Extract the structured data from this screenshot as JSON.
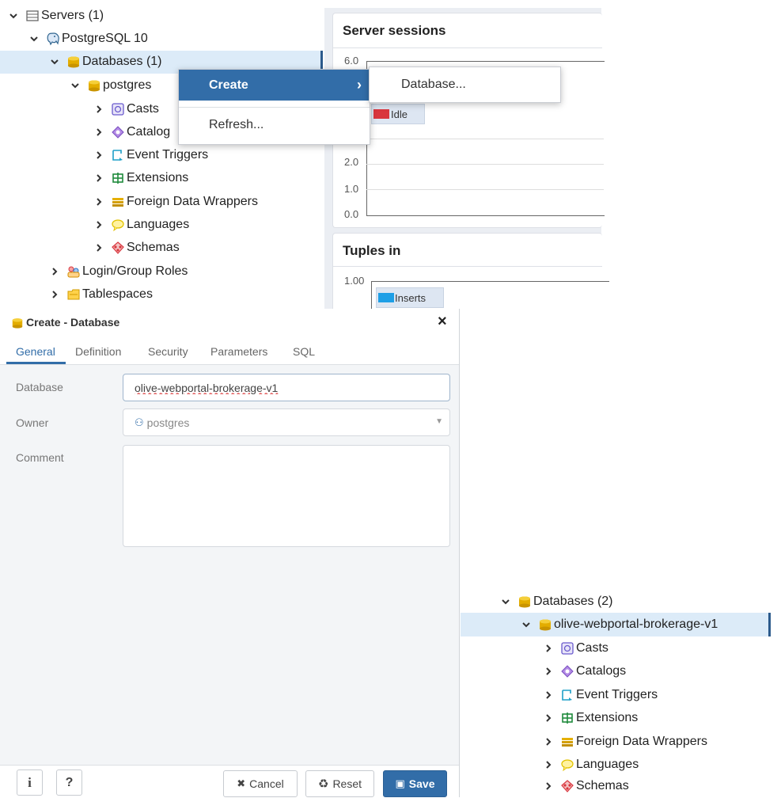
{
  "tree_top": {
    "servers": "Servers (1)",
    "postgresql": "PostgreSQL 10",
    "databases": "Databases (1)",
    "postgres": "postgres",
    "children": [
      "Casts",
      "Catalog",
      "Event Triggers",
      "Extensions",
      "Foreign Data Wrappers",
      "Languages",
      "Schemas"
    ],
    "login_roles": "Login/Group Roles",
    "tablespaces": "Tablespaces"
  },
  "dashboard": {
    "sessions_title": "Server sessions",
    "sessions_ticks": [
      "6.0",
      "2.0",
      "1.0",
      "0.0"
    ],
    "sessions_legend": "Idle",
    "tuples_title": "Tuples in",
    "tuples_tick": "1.00",
    "tuples_legend": "Inserts",
    "colors": {
      "idle": "#d9363e",
      "inserts": "#1e9fe6"
    }
  },
  "context_menu": {
    "create": "Create",
    "refresh": "Refresh...",
    "submenu_database": "Database..."
  },
  "dialog": {
    "title": "Create - Database",
    "close": "×",
    "tabs": [
      "General",
      "Definition",
      "Security",
      "Parameters",
      "SQL"
    ],
    "active_tab": "General",
    "database_label": "Database",
    "database_value": "olive-webportal-brokerage-v1",
    "owner_label": "Owner",
    "owner_value": "postgres",
    "comment_label": "Comment",
    "comment_value": "",
    "info_button": "i",
    "help_button": "?",
    "cancel": "Cancel",
    "reset": "Reset",
    "save": "Save"
  },
  "tree_bottom": {
    "databases": "Databases (2)",
    "database": "olive-webportal-brokerage-v1",
    "children": [
      "Casts",
      "Catalogs",
      "Event Triggers",
      "Extensions",
      "Foreign Data Wrappers",
      "Languages",
      "Schemas"
    ]
  }
}
